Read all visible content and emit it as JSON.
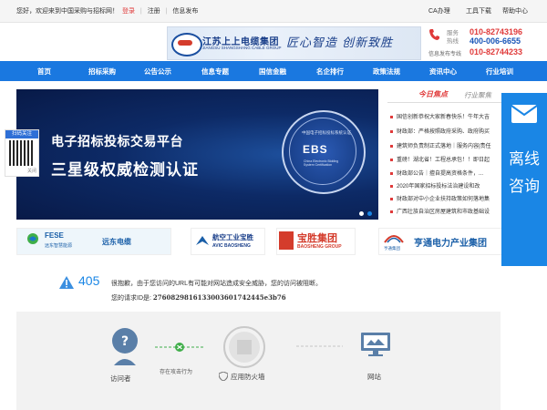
{
  "topbar": {
    "greeting": "您好，欢迎来到中国采购与招标网！",
    "login": "登录",
    "register": "注册",
    "publish": "信息发布",
    "ca": "CA办理",
    "tools": "工具下载",
    "help": "帮助中心"
  },
  "banner": {
    "company_cn": "江苏上上电缆集团",
    "company_en": "JIANGSU SHANGSHANG CABLE GROUP",
    "slogan": "匠心智造  创新致胜"
  },
  "contact": {
    "service_label_1": "服务",
    "service_label_2": "热线",
    "phone_1": "010-82743196",
    "phone_2": "400-006-6655",
    "publish_label": "信息发布专线",
    "phone_3": "010-82744233"
  },
  "nav": {
    "items": [
      "首页",
      "招标采购",
      "公告公示",
      "信息专题",
      "国信金融",
      "名企排行",
      "政策法规",
      "资讯中心",
      "行业培训"
    ]
  },
  "hero": {
    "line1": "电子招标投标交易平台",
    "line2": "三星级权威检测认证",
    "badge_title": "EBS",
    "badge_ring_text": "中国电子招标投标系统认证",
    "badge_sub": "China Electronic Bidding System Certification"
  },
  "qr_float": {
    "title": "扫码关注",
    "close": "关闭"
  },
  "news": {
    "tab_today": "今日焦点",
    "tab_industry": "行业聚焦",
    "items": [
      "国信创新恭祝大家新春快乐！牛年大吉",
      "财政部：严格按照政府采购、政府购买",
      "建筑师负责制正式落地｜服务内容|责任",
      "重磅！湖北省！工程总承包！！即日起",
      "财政部公告｜擅自提高资格条件，...",
      "2020年国家招标投标法治建设和改",
      "财政部对中小企业扶持政策如何落地集",
      "广西壮族自治区房屋建筑和市政基础设"
    ]
  },
  "logos": {
    "fese_main": "FESE",
    "fese_sub": "远东智慧能源",
    "fese_cable": "远东电缆",
    "avic_cn": "航空工业宝胜",
    "avic_en": "AVIC BAOSHENG",
    "bs_cn": "宝胜集团",
    "bs_en": "BAOSHENG GROUP",
    "hengtong_small": "亨通集团",
    "hengtong": "亨通电力产业集团"
  },
  "side_panel": {
    "text": "离线咨询"
  },
  "error": {
    "code": "405",
    "message": "很抱歉，由于您访问的URL有可能对网站造成安全威胁，您的访问被阻断。",
    "request_label": "您的请求ID是:",
    "request_id": "2760829816133003601742445e3b76"
  },
  "diagram": {
    "visitor": "访问者",
    "attack": "存在攻击行为",
    "firewall": "应用防火墙",
    "site": "网站"
  },
  "colors": {
    "nav_blue": "#1a78e0",
    "accent_red": "#e03a3a",
    "side_blue": "#1a86e5"
  }
}
